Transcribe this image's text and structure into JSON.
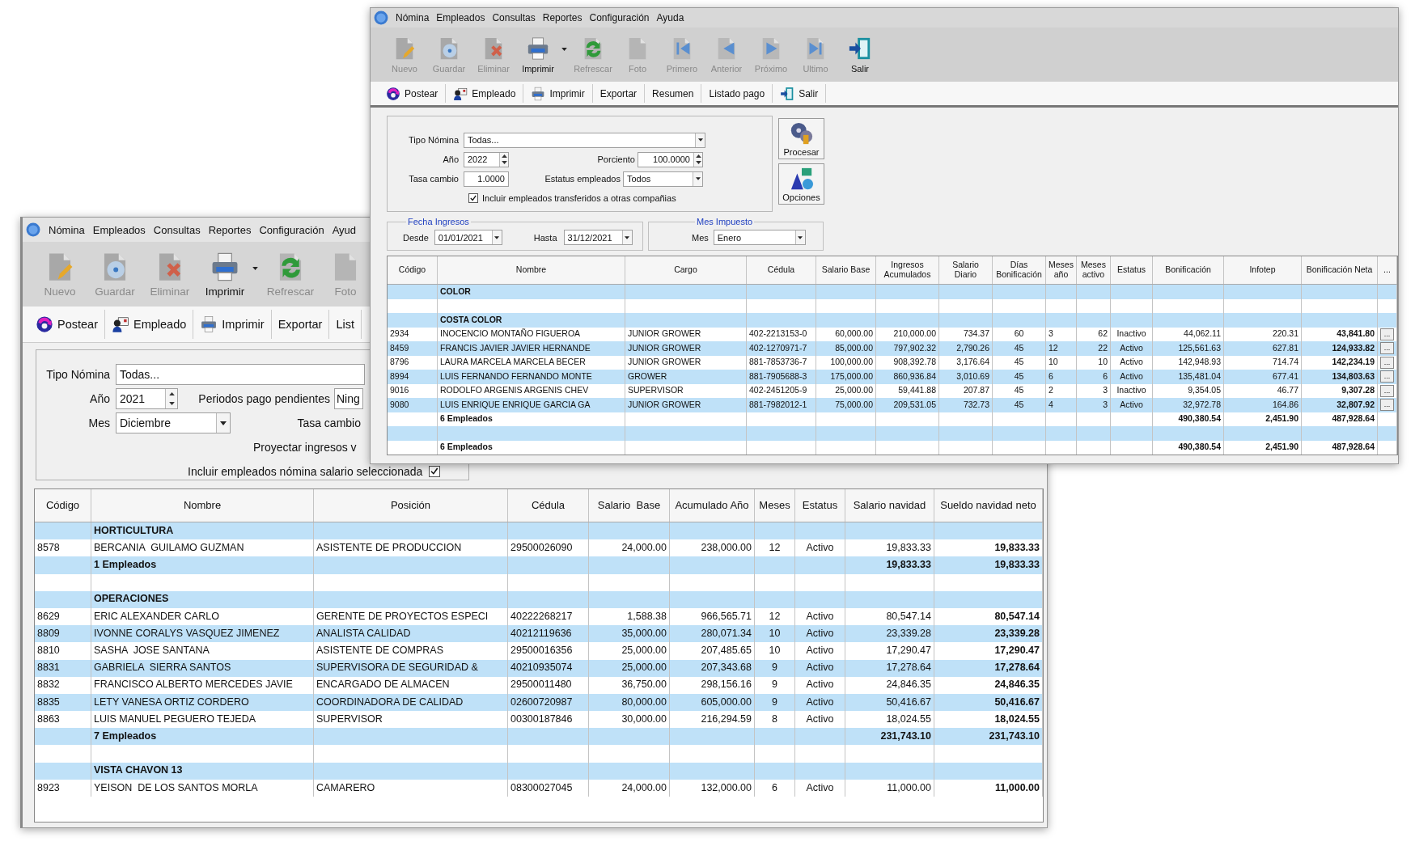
{
  "back_window": {
    "menu": [
      "Nómina",
      "Empleados",
      "Consultas",
      "Reportes",
      "Configuración",
      "Ayud"
    ],
    "toolbar": [
      {
        "label": "Nuevo",
        "disabled": true,
        "dropdown": false
      },
      {
        "label": "Guardar",
        "disabled": true,
        "dropdown": false
      },
      {
        "label": "Eliminar",
        "disabled": true,
        "dropdown": false
      },
      {
        "label": "Imprimir",
        "disabled": false,
        "dropdown": true
      },
      {
        "label": "Refrescar",
        "disabled": true,
        "dropdown": false
      },
      {
        "label": "Foto",
        "disabled": true,
        "dropdown": false
      }
    ],
    "actionbar": [
      "Postear",
      "Empleado",
      "Imprimir",
      "Exportar",
      "List"
    ],
    "form": {
      "tipo_nomina": {
        "label": "Tipo Nómina",
        "value": "Todas..."
      },
      "anio": {
        "label": "Año",
        "value": "2021"
      },
      "periodos": {
        "label": "Periodos pago pendientes",
        "value": "Ning"
      },
      "mes": {
        "label": "Mes",
        "value": "Diciembre"
      },
      "tasa_cambio_label": "Tasa cambio",
      "proyectar_label": "Proyectar ingresos v",
      "incluir": {
        "label": "Incluir empleados nómina salario seleccionada",
        "checked": true
      }
    },
    "table": {
      "columns": [
        "Código",
        "Nombre",
        "Posición",
        "Cédula",
        "Salario  Base",
        "Acumulado Año",
        "Meses",
        "Estatus",
        "Salario navidad",
        "Sueldo navidad neto"
      ],
      "rows": [
        {
          "kind": "group",
          "label": "HORTICULTURA"
        },
        {
          "kind": "data",
          "cells": [
            "8578",
            "BERCANIA  GUILAMO GUZMAN",
            "ASISTENTE DE PRODUCCION",
            "29500026090",
            "24,000.00",
            "238,000.00",
            "12",
            "Activo",
            "19,833.33",
            "19,833.33"
          ]
        },
        {
          "kind": "total",
          "label": "1 Empleados",
          "values": [
            "19,833.33",
            "19,833.33"
          ]
        },
        {
          "kind": "blank"
        },
        {
          "kind": "group",
          "label": "OPERACIONES"
        },
        {
          "kind": "data",
          "cells": [
            "8629",
            "ERIC ALEXANDER CARLO",
            "GERENTE DE PROYECTOS ESPECI",
            "40222268217",
            "1,588.38",
            "966,565.71",
            "12",
            "Activo",
            "80,547.14",
            "80,547.14"
          ]
        },
        {
          "kind": "data",
          "cells": [
            "8809",
            "IVONNE CORALYS VASQUEZ JIMENEZ",
            "ANALISTA CALIDAD",
            "40212119636",
            "35,000.00",
            "280,071.34",
            "10",
            "Activo",
            "23,339.28",
            "23,339.28"
          ]
        },
        {
          "kind": "data",
          "cells": [
            "8810",
            "SASHA  JOSE SANTANA",
            "ASISTENTE DE COMPRAS",
            "29500016356",
            "25,000.00",
            "207,485.65",
            "10",
            "Activo",
            "17,290.47",
            "17,290.47"
          ]
        },
        {
          "kind": "data",
          "cells": [
            "8831",
            "GABRIELA  SIERRA SANTOS",
            "SUPERVISORA DE SEGURIDAD &",
            "40210935074",
            "25,000.00",
            "207,343.68",
            "9",
            "Activo",
            "17,278.64",
            "17,278.64"
          ]
        },
        {
          "kind": "data",
          "cells": [
            "8832",
            "FRANCISCO ALBERTO MERCEDES JAVIE",
            "ENCARGADO DE ALMACEN",
            "29500011480",
            "36,750.00",
            "298,156.16",
            "9",
            "Activo",
            "24,846.35",
            "24,846.35"
          ]
        },
        {
          "kind": "data",
          "cells": [
            "8835",
            "LETY VANESA ORTIZ CORDERO",
            "COORDINADORA DE CALIDAD",
            "02600720987",
            "80,000.00",
            "605,000.00",
            "9",
            "Activo",
            "50,416.67",
            "50,416.67"
          ]
        },
        {
          "kind": "data",
          "cells": [
            "8863",
            "LUIS MANUEL PEGUERO TEJEDA",
            "SUPERVISOR",
            "00300187846",
            "30,000.00",
            "216,294.59",
            "8",
            "Activo",
            "18,024.55",
            "18,024.55"
          ]
        },
        {
          "kind": "total",
          "label": "7 Empleados",
          "values": [
            "231,743.10",
            "231,743.10"
          ]
        },
        {
          "kind": "blank"
        },
        {
          "kind": "group",
          "label": "VISTA CHAVON 13"
        },
        {
          "kind": "data",
          "cells": [
            "8923",
            "YEISON  DE LOS SANTOS MORLA",
            "CAMARERO",
            "08300027045",
            "24,000.00",
            "132,000.00",
            "6",
            "Activo",
            "11,000.00",
            "11,000.00"
          ]
        }
      ]
    }
  },
  "front_window": {
    "menu": [
      "Nómina",
      "Empleados",
      "Consultas",
      "Reportes",
      "Configuración",
      "Ayuda"
    ],
    "toolbar": [
      {
        "label": "Nuevo",
        "disabled": true,
        "dropdown": false
      },
      {
        "label": "Guardar",
        "disabled": true,
        "dropdown": false
      },
      {
        "label": "Eliminar",
        "disabled": true,
        "dropdown": false
      },
      {
        "label": "Imprimir",
        "disabled": false,
        "dropdown": true
      },
      {
        "label": "Refrescar",
        "disabled": true,
        "dropdown": false
      },
      {
        "label": "Foto",
        "disabled": true,
        "dropdown": false
      },
      {
        "label": "Primero",
        "disabled": true,
        "dropdown": false
      },
      {
        "label": "Anterior",
        "disabled": true,
        "dropdown": false
      },
      {
        "label": "Próximo",
        "disabled": true,
        "dropdown": false
      },
      {
        "label": "Ultimo",
        "disabled": true,
        "dropdown": false
      },
      {
        "label": "Salir",
        "disabled": false,
        "dropdown": false
      }
    ],
    "actionbar": [
      "Postear",
      "Empleado",
      "Imprimir",
      "Exportar",
      "Resumen",
      "Listado pago",
      "Salir"
    ],
    "form": {
      "tipo_nomina": {
        "label": "Tipo Nómina",
        "value": "Todas..."
      },
      "anio": {
        "label": "Año",
        "value": "2022"
      },
      "porciento": {
        "label": "Porciento",
        "value": "100.0000"
      },
      "tasa_cambio": {
        "label": "Tasa cambio",
        "value": "1.0000"
      },
      "estatus": {
        "label": "Estatus empleados",
        "value": "Todos"
      },
      "incluir": {
        "label": "Incluir empleados transferidos a otras compañias",
        "checked": true
      }
    },
    "side_buttons": [
      "Procesar",
      "Opciones"
    ],
    "fecha_ingresos": {
      "title": "Fecha Ingresos",
      "desde": {
        "label": "Desde",
        "value": "01/01/2021"
      },
      "hasta": {
        "label": "Hasta",
        "value": "31/12/2021"
      }
    },
    "mes_impuesto": {
      "title": "Mes Impuesto",
      "mes": {
        "label": "Mes",
        "value": "Enero"
      }
    },
    "table": {
      "columns": [
        "Código",
        "Nombre",
        "Cargo",
        "Cédula",
        "Salario Base",
        "Ingresos Acumulados",
        "Salario Diario",
        "Días Bonificación",
        "Meses año",
        "Meses activo",
        "Estatus",
        "Bonificación",
        "Infotep",
        "Bonificación Neta",
        "..."
      ],
      "rows": [
        {
          "kind": "group",
          "label": "COLOR"
        },
        {
          "kind": "blank"
        },
        {
          "kind": "group",
          "label": "COSTA COLOR"
        },
        {
          "kind": "data",
          "cells": [
            "2934",
            "INOCENCIO MONTAÑO FIGUEROA",
            "JUNIOR GROWER",
            "402-2213153-0",
            "60,000.00",
            "210,000.00",
            "734.37",
            "60",
            "3",
            "62",
            "Inactivo",
            "44,062.11",
            "220.31",
            "43,841.80"
          ],
          "button": "..."
        },
        {
          "kind": "data",
          "cells": [
            "8459",
            "FRANCIS JAVIER JAVIER HERNANDE",
            "JUNIOR GROWER",
            "402-1270971-7",
            "85,000.00",
            "797,902.32",
            "2,790.26",
            "45",
            "12",
            "22",
            "Activo",
            "125,561.63",
            "627.81",
            "124,933.82"
          ],
          "button": "..."
        },
        {
          "kind": "data",
          "cells": [
            "8796",
            "LAURA MARCELA MARCELA BECER",
            "JUNIOR GROWER",
            "881-7853736-7",
            "100,000.00",
            "908,392.78",
            "3,176.64",
            "45",
            "10",
            "10",
            "Activo",
            "142,948.93",
            "714.74",
            "142,234.19"
          ],
          "button": "..."
        },
        {
          "kind": "data",
          "cells": [
            "8994",
            "LUIS FERNANDO FERNANDO MONTE",
            "GROWER",
            "881-7905688-3",
            "175,000.00",
            "860,936.84",
            "3,010.69",
            "45",
            "6",
            "6",
            "Activo",
            "135,481.04",
            "677.41",
            "134,803.63"
          ],
          "button": "..."
        },
        {
          "kind": "data",
          "cells": [
            "9016",
            "RODOLFO ARGENIS ARGENIS CHEV",
            "SUPERVISOR",
            "402-2451205-9",
            "25,000.00",
            "59,441.88",
            "207.87",
            "45",
            "2",
            "3",
            "Inactivo",
            "9,354.05",
            "46.77",
            "9,307.28"
          ],
          "button": "..."
        },
        {
          "kind": "data",
          "cells": [
            "9080",
            "LUIS ENRIQUE ENRIQUE GARCIA GA",
            "JUNIOR GROWER",
            "881-7982012-1",
            "75,000.00",
            "209,531.05",
            "732.73",
            "45",
            "4",
            "3",
            "Activo",
            "32,972.78",
            "164.86",
            "32,807.92"
          ],
          "button": "..."
        },
        {
          "kind": "total",
          "label": "6 Empleados",
          "values": [
            "490,380.54",
            "2,451.90",
            "487,928.64"
          ]
        },
        {
          "kind": "blank"
        },
        {
          "kind": "total",
          "label": "6 Empleados",
          "values": [
            "490,380.54",
            "2,451.90",
            "487,928.64"
          ]
        }
      ]
    }
  }
}
